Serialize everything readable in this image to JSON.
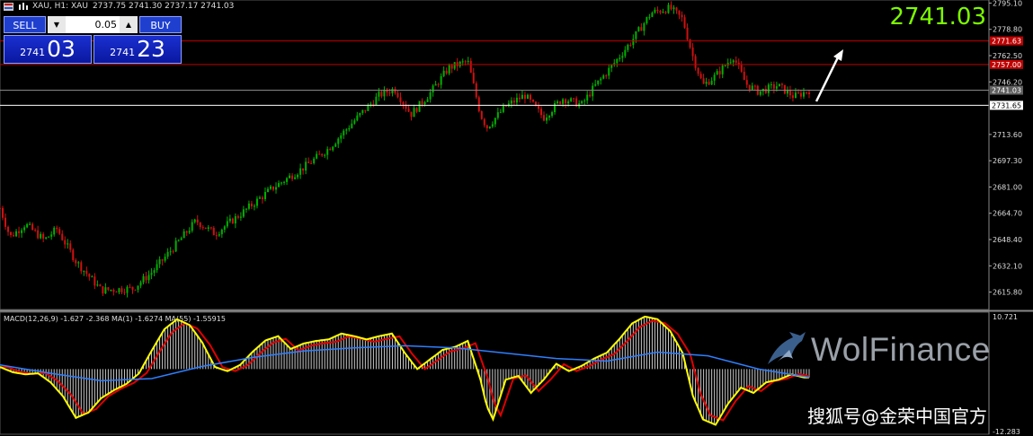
{
  "header": {
    "symbol_info": "XAU, H1: XAU",
    "ohlc": "2737.75 2741.30 2737.17 2741.03"
  },
  "trade_panel": {
    "sell_label": "SELL",
    "buy_label": "BUY",
    "lot": "0.05",
    "sell_small": "2741",
    "sell_big": "03",
    "buy_small": "2741",
    "buy_big": "23"
  },
  "current_price_display": "2741.03",
  "watermark": {
    "brand": "WolFinance",
    "source": "搜狐号@金荣中国官方"
  },
  "colors": {
    "background": "#000000",
    "bull_candle": "#00b000",
    "bear_candle": "#d01010",
    "macd_line": "#ffff00",
    "signal_line": "#e00000",
    "ma55_line": "#2e7fff",
    "histogram": "#c8c8c8",
    "big_price": "#7cfc00"
  },
  "chart_data": [
    {
      "type": "candlestick",
      "timeframe": "H1",
      "y_ticks": [
        "2795.10",
        "2778.80",
        "2762.50",
        "2746.20",
        "2713.60",
        "2697.30",
        "2681.00",
        "2664.70",
        "2648.40",
        "2632.10",
        "2615.80"
      ],
      "ylim": [
        2605,
        2797
      ],
      "price_tags": [
        {
          "label": "2771.63",
          "value": 2771.63,
          "color": "#c00000",
          "line": "#c00000"
        },
        {
          "label": "2757.00",
          "value": 2757.0,
          "color": "#c00000",
          "line": "#c00000"
        },
        {
          "label": "2741.03",
          "value": 2741.03,
          "color": "#606060",
          "line": "#909090"
        },
        {
          "label": "2731.65",
          "value": 2731.65,
          "color": "#ffffff",
          "line": "#ffffff"
        }
      ],
      "key_closes": [
        {
          "x": 0,
          "close": 2668
        },
        {
          "x": 8,
          "close": 2650
        },
        {
          "x": 20,
          "close": 2658
        },
        {
          "x": 35,
          "close": 2648
        },
        {
          "x": 45,
          "close": 2655
        },
        {
          "x": 60,
          "close": 2635
        },
        {
          "x": 80,
          "close": 2617
        },
        {
          "x": 105,
          "close": 2618
        },
        {
          "x": 120,
          "close": 2628
        },
        {
          "x": 140,
          "close": 2646
        },
        {
          "x": 155,
          "close": 2660
        },
        {
          "x": 170,
          "close": 2652
        },
        {
          "x": 190,
          "close": 2664
        },
        {
          "x": 215,
          "close": 2680
        },
        {
          "x": 240,
          "close": 2693
        },
        {
          "x": 260,
          "close": 2705
        },
        {
          "x": 280,
          "close": 2722
        },
        {
          "x": 300,
          "close": 2738
        },
        {
          "x": 312,
          "close": 2742
        },
        {
          "x": 325,
          "close": 2726
        },
        {
          "x": 340,
          "close": 2739
        },
        {
          "x": 355,
          "close": 2755
        },
        {
          "x": 370,
          "close": 2759
        },
        {
          "x": 380,
          "close": 2726
        },
        {
          "x": 385,
          "close": 2718
        },
        {
          "x": 400,
          "close": 2731
        },
        {
          "x": 415,
          "close": 2738
        },
        {
          "x": 430,
          "close": 2724
        },
        {
          "x": 445,
          "close": 2736
        },
        {
          "x": 460,
          "close": 2732
        },
        {
          "x": 470,
          "close": 2743
        },
        {
          "x": 485,
          "close": 2757
        },
        {
          "x": 500,
          "close": 2772
        },
        {
          "x": 515,
          "close": 2789
        },
        {
          "x": 530,
          "close": 2792
        },
        {
          "x": 540,
          "close": 2785
        },
        {
          "x": 548,
          "close": 2762
        },
        {
          "x": 556,
          "close": 2744
        },
        {
          "x": 566,
          "close": 2750
        },
        {
          "x": 580,
          "close": 2762
        },
        {
          "x": 590,
          "close": 2745
        },
        {
          "x": 600,
          "close": 2740
        },
        {
          "x": 615,
          "close": 2744
        },
        {
          "x": 628,
          "close": 2737
        },
        {
          "x": 640,
          "close": 2741
        }
      ]
    },
    {
      "type": "line",
      "title": "MACD(12,26,9) -1.627 -2.368 MA(1) -1.6274 MA(55) -1.55915",
      "y_ticks": [
        "10.721",
        "-12.283"
      ],
      "ylim": [
        -12.283,
        10.721
      ],
      "series": [
        {
          "name": "MACD",
          "style": "histogram+line",
          "values": [
            [
              0,
              0.4
            ],
            [
              10,
              -0.6
            ],
            [
              20,
              -1.0
            ],
            [
              30,
              -0.8
            ],
            [
              40,
              -2.5
            ],
            [
              50,
              -5.2
            ],
            [
              60,
              -9.2
            ],
            [
              70,
              -8.2
            ],
            [
              80,
              -5.5
            ],
            [
              90,
              -4.0
            ],
            [
              100,
              -2.8
            ],
            [
              110,
              -0.8
            ],
            [
              120,
              3.5
            ],
            [
              130,
              7.5
            ],
            [
              140,
              9.4
            ],
            [
              150,
              8.3
            ],
            [
              160,
              5.0
            ],
            [
              170,
              0.4
            ],
            [
              180,
              -0.4
            ],
            [
              190,
              0.8
            ],
            [
              200,
              3.3
            ],
            [
              210,
              5.4
            ],
            [
              220,
              6.2
            ],
            [
              230,
              3.8
            ],
            [
              240,
              4.8
            ],
            [
              250,
              5.3
            ],
            [
              260,
              5.6
            ],
            [
              270,
              6.7
            ],
            [
              280,
              6.2
            ],
            [
              290,
              5.6
            ],
            [
              300,
              6.2
            ],
            [
              310,
              6.7
            ],
            [
              320,
              3.1
            ],
            [
              330,
              0.0
            ],
            [
              340,
              1.8
            ],
            [
              350,
              3.6
            ],
            [
              360,
              4.2
            ],
            [
              370,
              5.3
            ],
            [
              380,
              -2.0
            ],
            [
              385,
              -7.0
            ],
            [
              390,
              -9.5
            ],
            [
              400,
              -2.0
            ],
            [
              410,
              -1.3
            ],
            [
              420,
              -4.5
            ],
            [
              430,
              -2.0
            ],
            [
              440,
              1.0
            ],
            [
              450,
              -0.4
            ],
            [
              460,
              0.6
            ],
            [
              470,
              2.0
            ],
            [
              480,
              3.1
            ],
            [
              490,
              5.7
            ],
            [
              500,
              8.6
            ],
            [
              510,
              9.9
            ],
            [
              520,
              9.4
            ],
            [
              530,
              7.2
            ],
            [
              540,
              3.0
            ],
            [
              548,
              -5.0
            ],
            [
              556,
              -9.5
            ],
            [
              566,
              -10.5
            ],
            [
              576,
              -6.5
            ],
            [
              586,
              -3.5
            ],
            [
              596,
              -4.5
            ],
            [
              606,
              -2.5
            ],
            [
              616,
              -2.0
            ],
            [
              626,
              -1.0
            ],
            [
              636,
              -1.6
            ],
            [
              640,
              -1.6
            ]
          ]
        },
        {
          "name": "MA(55)",
          "values": [
            [
              0,
              0.8
            ],
            [
              40,
              -0.8
            ],
            [
              80,
              -2.2
            ],
            [
              120,
              -1.8
            ],
            [
              160,
              0.5
            ],
            [
              200,
              2.2
            ],
            [
              240,
              3.4
            ],
            [
              280,
              4.0
            ],
            [
              320,
              4.4
            ],
            [
              360,
              4.0
            ],
            [
              400,
              3.0
            ],
            [
              440,
              2.0
            ],
            [
              480,
              1.5
            ],
            [
              520,
              3.2
            ],
            [
              560,
              2.5
            ],
            [
              600,
              0.0
            ],
            [
              640,
              -1.56
            ]
          ]
        }
      ]
    }
  ]
}
